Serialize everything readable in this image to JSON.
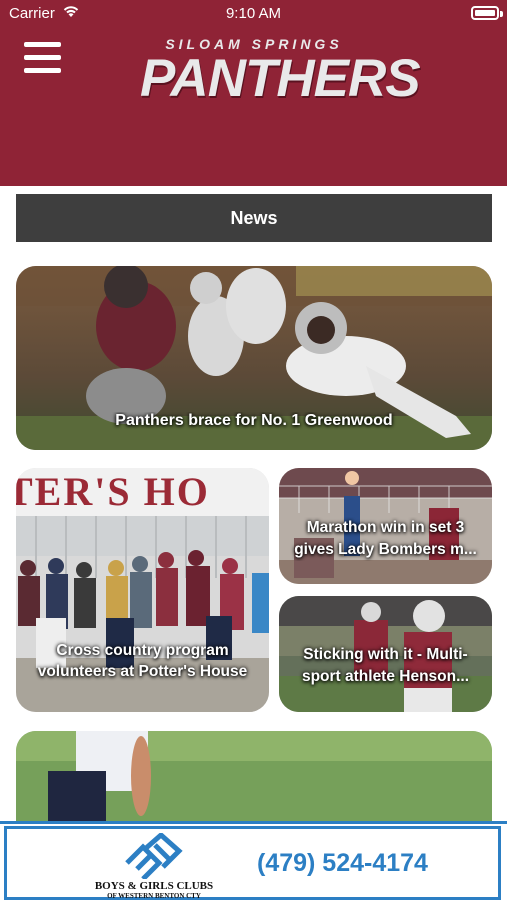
{
  "status": {
    "carrier": "Carrier",
    "time": "9:10 AM"
  },
  "header": {
    "logo_line1": "SILOAM SPRINGS",
    "logo_line2": "PANTHERS"
  },
  "section": {
    "title": "News"
  },
  "articles": [
    {
      "caption": "Panthers brace for No. 1 Greenwood"
    },
    {
      "caption_line1": "Cross country program",
      "caption_line2": "volunteers at Potter's House"
    },
    {
      "caption_line1": "Marathon win in set 3",
      "caption_line2": "gives Lady Bombers m..."
    },
    {
      "caption_line1": "Sticking with it - Multi-",
      "caption_line2": "sport athlete Henson..."
    },
    {
      "caption": ""
    }
  ],
  "banner_text": {
    "sign": "TER'S  HO"
  },
  "ad": {
    "org_name": "BOYS & GIRLS CLUBS",
    "org_sub": "OF WESTERN BENTON CTY",
    "phone": "(479) 524-4174"
  },
  "colors": {
    "brand": "#8f2336",
    "news_bar": "#3e3e3e",
    "ad_blue": "#2c7fc4"
  },
  "icons": [
    "wifi-icon",
    "battery-icon",
    "hamburger-menu-icon",
    "boys-girls-clubs-logo"
  ]
}
